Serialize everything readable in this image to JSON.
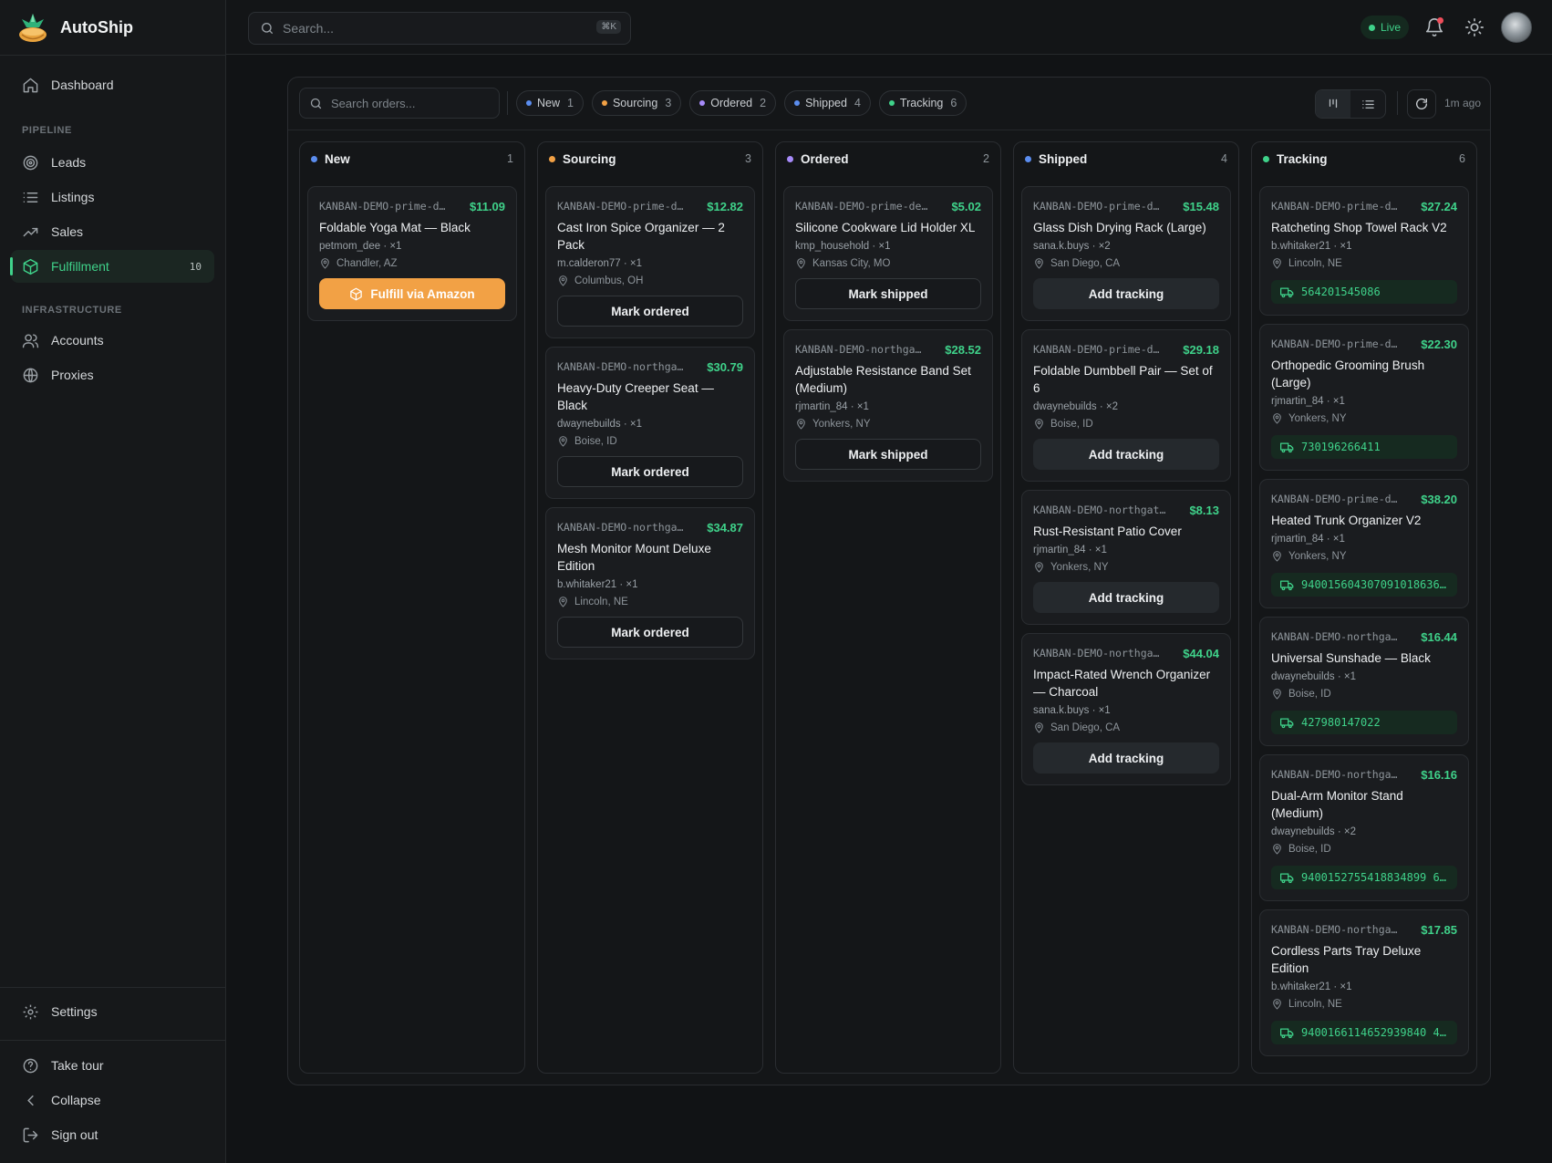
{
  "app": {
    "name": "AutoShip",
    "search_placeholder": "Search...",
    "search_shortcut": "⌘K",
    "live_label": "Live"
  },
  "sidebar": {
    "top_items": [
      {
        "label": "Dashboard",
        "icon": "home-icon"
      }
    ],
    "pipeline_label": "PIPELINE",
    "pipeline_items": [
      {
        "label": "Leads",
        "icon": "target-icon"
      },
      {
        "label": "Listings",
        "icon": "list-icon"
      },
      {
        "label": "Sales",
        "icon": "trending-up-icon"
      },
      {
        "label": "Fulfillment",
        "icon": "package-icon",
        "badge": "10",
        "active": true
      }
    ],
    "infrastructure_label": "INFRASTRUCTURE",
    "infrastructure_items": [
      {
        "label": "Accounts",
        "icon": "users-icon"
      },
      {
        "label": "Proxies",
        "icon": "globe-icon"
      }
    ],
    "settings_label": "Settings",
    "bottom_items": [
      {
        "label": "Take tour",
        "icon": "help-circle-icon"
      },
      {
        "label": "Collapse",
        "icon": "chevron-left-icon"
      },
      {
        "label": "Sign out",
        "icon": "sign-out-icon"
      }
    ]
  },
  "toolbar": {
    "search_placeholder": "Search orders...",
    "filters": [
      {
        "label": "New",
        "count": "1",
        "color": "#5b8def"
      },
      {
        "label": "Sourcing",
        "count": "3",
        "color": "#f2a145"
      },
      {
        "label": "Ordered",
        "count": "2",
        "color": "#a78bfa"
      },
      {
        "label": "Shipped",
        "count": "4",
        "color": "#5b8def"
      },
      {
        "label": "Tracking",
        "count": "6",
        "color": "#3fd28a"
      }
    ],
    "updated": "1m ago"
  },
  "columns": [
    {
      "title": "New",
      "count": "1",
      "color": "#5b8def",
      "cards": [
        {
          "id": "KANBAN-DEMO-prime-d…",
          "price": "$11.09",
          "title": "Foldable Yoga Mat — Black",
          "buyer": "petmom_dee · ×1",
          "location": "Chandler, AZ",
          "action": "Fulfill via Amazon",
          "action_style": "amazon"
        }
      ]
    },
    {
      "title": "Sourcing",
      "count": "3",
      "color": "#f2a145",
      "cards": [
        {
          "id": "KANBAN-DEMO-prime-d…",
          "price": "$12.82",
          "title": "Cast Iron Spice Organizer — 2 Pack",
          "buyer": "m.calderon77 · ×1",
          "location": "Columbus, OH",
          "action": "Mark ordered",
          "action_style": "outline"
        },
        {
          "id": "KANBAN-DEMO-northga…",
          "price": "$30.79",
          "title": "Heavy-Duty Creeper Seat — Black",
          "buyer": "dwaynebuilds · ×1",
          "location": "Boise, ID",
          "action": "Mark ordered",
          "action_style": "outline"
        },
        {
          "id": "KANBAN-DEMO-northga…",
          "price": "$34.87",
          "title": "Mesh Monitor Mount Deluxe Edition",
          "buyer": "b.whitaker21 · ×1",
          "location": "Lincoln, NE",
          "action": "Mark ordered",
          "action_style": "outline"
        }
      ]
    },
    {
      "title": "Ordered",
      "count": "2",
      "color": "#a78bfa",
      "cards": [
        {
          "id": "KANBAN-DEMO-prime-de…",
          "price": "$5.02",
          "title": "Silicone Cookware Lid Holder XL",
          "buyer": "kmp_household · ×1",
          "location": "Kansas City, MO",
          "action": "Mark shipped",
          "action_style": "outline"
        },
        {
          "id": "KANBAN-DEMO-northga…",
          "price": "$28.52",
          "title": "Adjustable Resistance Band Set (Medium)",
          "buyer": "rjmartin_84 · ×1",
          "location": "Yonkers, NY",
          "action": "Mark shipped",
          "action_style": "outline"
        }
      ]
    },
    {
      "title": "Shipped",
      "count": "4",
      "color": "#5b8def",
      "cards": [
        {
          "id": "KANBAN-DEMO-prime-d…",
          "price": "$15.48",
          "title": "Glass Dish Drying Rack (Large)",
          "buyer": "sana.k.buys · ×2",
          "location": "San Diego, CA",
          "action": "Add tracking",
          "action_style": "dark"
        },
        {
          "id": "KANBAN-DEMO-prime-d…",
          "price": "$29.18",
          "title": "Foldable Dumbbell Pair — Set of 6",
          "buyer": "dwaynebuilds · ×2",
          "location": "Boise, ID",
          "action": "Add tracking",
          "action_style": "dark"
        },
        {
          "id": "KANBAN-DEMO-northgat…",
          "price": "$8.13",
          "title": "Rust-Resistant Patio Cover",
          "buyer": "rjmartin_84 · ×1",
          "location": "Yonkers, NY",
          "action": "Add tracking",
          "action_style": "dark"
        },
        {
          "id": "KANBAN-DEMO-northga…",
          "price": "$44.04",
          "title": "Impact-Rated Wrench Organizer — Charcoal",
          "buyer": "sana.k.buys · ×1",
          "location": "San Diego, CA",
          "action": "Add tracking",
          "action_style": "dark"
        }
      ]
    },
    {
      "title": "Tracking",
      "count": "6",
      "color": "#3fd28a",
      "cards": [
        {
          "id": "KANBAN-DEMO-prime-d…",
          "price": "$27.24",
          "title": "Ratcheting Shop Towel Rack V2",
          "buyer": "b.whitaker21 · ×1",
          "location": "Lincoln, NE",
          "tracking": "564201545086"
        },
        {
          "id": "KANBAN-DEMO-prime-d…",
          "price": "$22.30",
          "title": "Orthopedic Grooming Brush (Large)",
          "buyer": "rjmartin_84 · ×1",
          "location": "Yonkers, NY",
          "tracking": "730196266411"
        },
        {
          "id": "KANBAN-DEMO-prime-d…",
          "price": "$38.20",
          "title": "Heated Trunk Organizer V2",
          "buyer": "rjmartin_84 · ×1",
          "location": "Yonkers, NY",
          "tracking": "940015604307091018636…"
        },
        {
          "id": "KANBAN-DEMO-northga…",
          "price": "$16.44",
          "title": "Universal Sunshade — Black",
          "buyer": "dwaynebuilds · ×1",
          "location": "Boise, ID",
          "tracking": "427980147022"
        },
        {
          "id": "KANBAN-DEMO-northga…",
          "price": "$16.16",
          "title": "Dual-Arm Monitor Stand (Medium)",
          "buyer": "dwaynebuilds · ×2",
          "location": "Boise, ID",
          "tracking": "9400152755418834899 60…"
        },
        {
          "id": "KANBAN-DEMO-northga…",
          "price": "$17.85",
          "title": "Cordless Parts Tray Deluxe Edition",
          "buyer": "b.whitaker21 · ×1",
          "location": "Lincoln, NE",
          "tracking": "9400166114652939840 43…"
        }
      ]
    }
  ]
}
